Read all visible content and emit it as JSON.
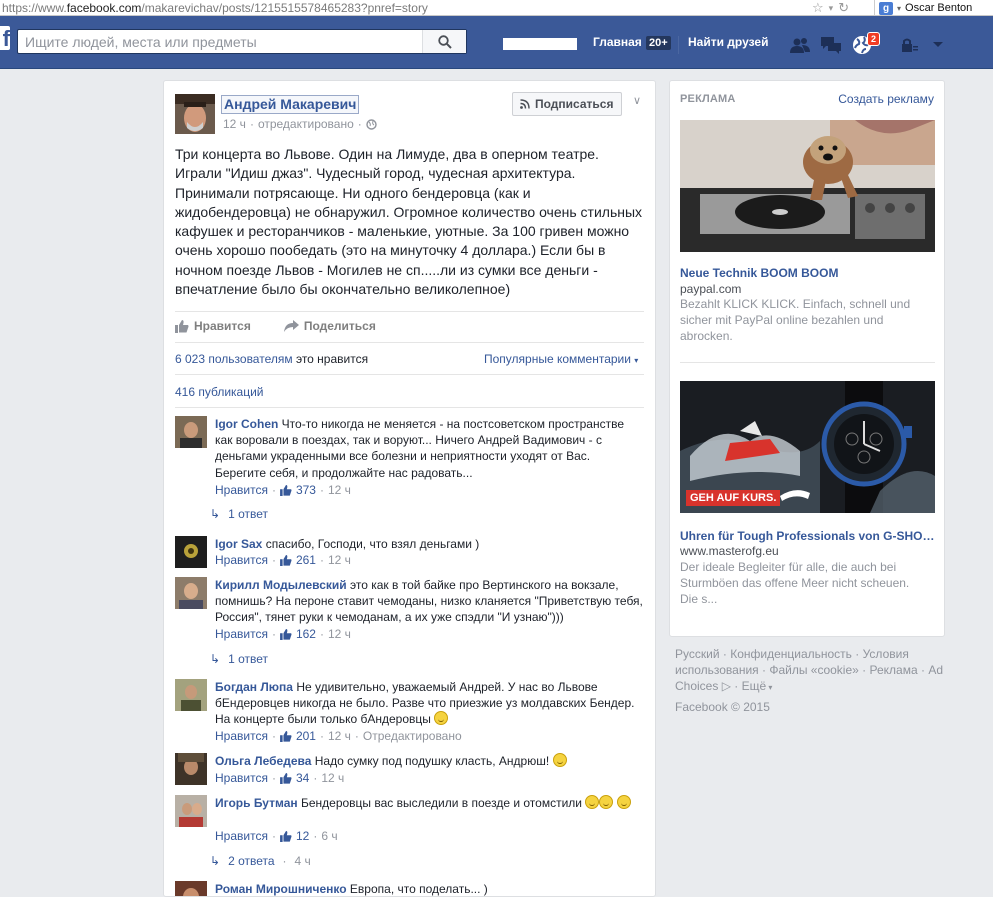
{
  "browser": {
    "url_prefix": "https://www.",
    "url_domain": "facebook.com",
    "url_rest": "/makarevichav/posts/1215515578465283?pnref=story",
    "user": "Oscar Benton"
  },
  "fbbar": {
    "logo": "f",
    "search_placeholder": "Ищите людей, места или предметы",
    "home_label": "Главная",
    "home_count": "20+",
    "find_friends": "Найти друзей",
    "notif_count": "2"
  },
  "post": {
    "author": "Андрей Макаревич",
    "time": "12 ч",
    "edited": "отредактировано",
    "follow": "Подписаться",
    "text": "Три концерта во Львове. Один на Лимуде, два в оперном театре. Играли \"Идиш джаз\". Чудесный город, чудесная архитектура. Принимали потрясающе. Ни одного бендеровца (как и жидобендеровца) не обнаружил. Огромное количество очень стильных кафушек и ресторанчиков - маленькие, уютные. За 100 гривен можно очень хорошо пообедать (это на минуточку 4 доллара.) Если бы в ночном поезде Львов - Могилев не сп.....ли из сумки все деньги - впечатление было бы окончательно великолепное)",
    "like_action": "Нравится",
    "share_action": "Поделиться",
    "likes_count": "6 023 пользователям",
    "likes_suffix": "это нравится",
    "popular_comments": "Популярные комментарии",
    "shares": "416 публикаций"
  },
  "comments": [
    {
      "name": "Igor Cohen",
      "text": "Что-то никогда не меняется - на постсоветском пространстве как воровали в поездах, так и воруют... Ничего Андрей Вадимович - с деньгами украденными все болезни и неприятности уходят от Вас. Берегите себя, и продолжайте нас радовать...",
      "like": "Нравится",
      "count": "373",
      "time": "12 ч",
      "reply": "1 ответ"
    },
    {
      "name": "Igor Sax",
      "text": "спасибо, Господи, что взял деньгами )",
      "like": "Нравится",
      "count": "261",
      "time": "12 ч"
    },
    {
      "name": "Кирилл Модылевский",
      "text": "это как в той байке про Вертинского на вокзале, помнишь? На пероне ставит чемоданы, низко кланяется \"Приветствую тебя, Россия\", тянет руки к чемоданам, а их уже спэдли \"И узнаю\")))",
      "like": "Нравится",
      "count": "162",
      "time": "12 ч",
      "reply": "1 ответ"
    },
    {
      "name": "Богдан Люпа",
      "text": "Не удивительно, уважаемый Андрей. У нас во Львове бЕндеровцев никогда не было. Разве что приезжие уз молдавских Бендер. На концерте были только бАндеровцы",
      "like": "Нравится",
      "count": "201",
      "time": "12 ч",
      "edited": "Отредактировано"
    },
    {
      "name": "Ольга Лебедева",
      "text": "Надо сумку под подушку класть, Андрюш!",
      "like": "Нравится",
      "count": "34",
      "time": "12 ч"
    },
    {
      "name": "Игорь Бутман",
      "text": "Бендеровцы вас выследили в поезде и отомстили",
      "like": "Нравится",
      "count": "12",
      "time": "6 ч",
      "reply": "2 ответа",
      "reply_time": "4 ч"
    },
    {
      "name": "Роман Мирошниченко",
      "text": "Европа, что поделать... )"
    }
  ],
  "ads": {
    "title": "РЕКЛАМА",
    "create": "Создать рекламу",
    "items": [
      {
        "title": "Neue Technik BOOM BOOM",
        "domain": "paypal.com",
        "desc": "Bezahlt KLICK KLICK. Einfach, schnell und sicher mit PayPal online bezahlen und abrocken."
      },
      {
        "title": "Uhren für Tough Professionals von G-SHO…",
        "domain": "www.masterofg.eu",
        "desc": "Der ideale Begleiter für alle, die auch bei Sturmböen das offene Meer nicht scheuen. Die s...",
        "banner": "GEH AUF KURS."
      }
    ]
  },
  "footer": {
    "links": [
      "Русский",
      "Конфиденциальность",
      "Условия использования",
      "Файлы «cookie»",
      "Реклама",
      "Ad Choices",
      "Ещё"
    ],
    "copyright": "Facebook © 2015"
  },
  "colors": {
    "fb_blue": "#3b5998",
    "link": "#365899",
    "muted": "#90949c"
  }
}
